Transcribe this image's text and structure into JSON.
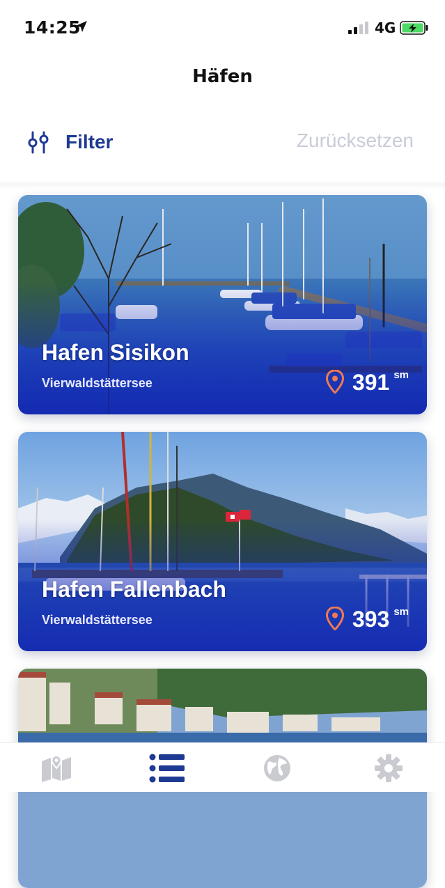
{
  "status": {
    "time": "14:25",
    "network": "4G"
  },
  "header": {
    "title": "Häfen"
  },
  "filter": {
    "label": "Filter",
    "reset_label": "Zurücksetzen"
  },
  "harbors": [
    {
      "name": "Hafen Sisikon",
      "lake": "Vierwaldstättersee",
      "distance": "391",
      "unit": "sm"
    },
    {
      "name": "Hafen Fallenbach",
      "lake": "Vierwaldstättersee",
      "distance": "393",
      "unit": "sm"
    }
  ],
  "tabs": [
    {
      "icon": "map-icon",
      "active": false
    },
    {
      "icon": "list-icon",
      "active": true
    },
    {
      "icon": "globe-icon",
      "active": false
    },
    {
      "icon": "gear-icon",
      "active": false
    }
  ],
  "colors": {
    "accent": "#1f3a93",
    "muted": "#c8ccd8",
    "tab_inactive": "#c9cbd1",
    "pin": "#f07a52",
    "battery": "#4cd964"
  }
}
